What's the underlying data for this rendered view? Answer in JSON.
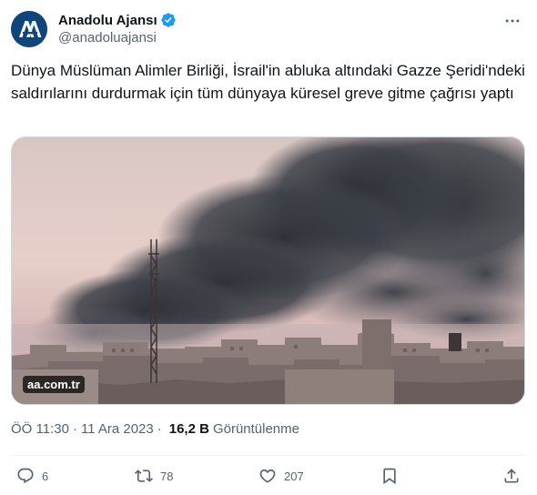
{
  "author": {
    "display_name": "Anadolu Ajansı",
    "handle": "@anadoluajansi",
    "verified": true
  },
  "tweet": {
    "text": "Dünya Müslüman Alimler Birliği, İsrail'in abluka altındaki Gazze Şeridi'ndeki saldırılarını durdurmak için tüm dünyaya küresel greve gitme çağrısı yaptı"
  },
  "media": {
    "source_label": "aa.com.tr"
  },
  "meta": {
    "time": "ÖÖ 11:30",
    "date": "11 Ara 2023",
    "separator": "·",
    "views_count": "16,2 B",
    "views_label": "Görüntülenme"
  },
  "actions": {
    "replies": "6",
    "reposts": "78",
    "likes": "207"
  },
  "colors": {
    "text": "#0f1419",
    "secondary": "#536471",
    "verified": "#1d9bf0",
    "avatar": "#10457b"
  },
  "icons": [
    "verified-badge-icon",
    "more-icon",
    "reply-icon",
    "repost-icon",
    "like-icon",
    "bookmark-icon",
    "share-icon"
  ]
}
